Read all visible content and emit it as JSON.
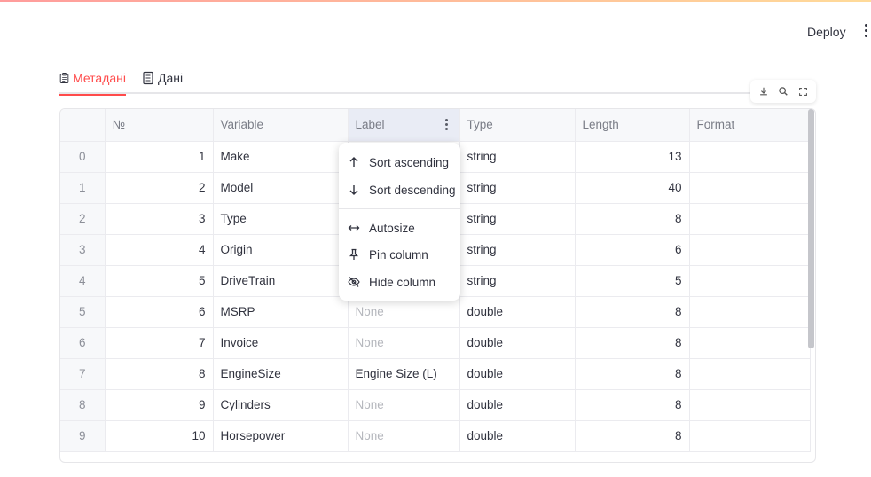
{
  "header": {
    "deploy_label": "Deploy",
    "menu_icon": "kebab-vertical-icon"
  },
  "tabs": [
    {
      "label": "Метадані",
      "icon": "clipboard-icon",
      "active": true
    },
    {
      "label": "Дані",
      "icon": "document-icon",
      "active": false
    }
  ],
  "toolbar": {
    "icons": [
      "download-icon",
      "search-icon",
      "fullscreen-icon"
    ]
  },
  "table": {
    "columns": [
      "",
      "№",
      "Variable",
      "Label",
      "Type",
      "Length",
      "Format"
    ],
    "rows": [
      [
        "0",
        "1",
        "Make",
        "",
        "string",
        "13",
        ""
      ],
      [
        "1",
        "2",
        "Model",
        "",
        "string",
        "40",
        ""
      ],
      [
        "2",
        "3",
        "Type",
        "",
        "string",
        "8",
        ""
      ],
      [
        "3",
        "4",
        "Origin",
        "",
        "string",
        "6",
        ""
      ],
      [
        "4",
        "5",
        "DriveTrain",
        "",
        "string",
        "5",
        ""
      ],
      [
        "5",
        "6",
        "MSRP",
        "None",
        "double",
        "8",
        ""
      ],
      [
        "6",
        "7",
        "Invoice",
        "None",
        "double",
        "8",
        ""
      ],
      [
        "7",
        "8",
        "EngineSize",
        "Engine Size (L)",
        "double",
        "8",
        ""
      ],
      [
        "8",
        "9",
        "Cylinders",
        "None",
        "double",
        "8",
        ""
      ],
      [
        "9",
        "10",
        "Horsepower",
        "None",
        "double",
        "8",
        ""
      ]
    ]
  },
  "column_menu": {
    "items": [
      {
        "label": "Sort ascending",
        "icon": "arrow-up-icon"
      },
      {
        "label": "Sort descending",
        "icon": "arrow-down-icon"
      },
      {
        "label": "Autosize",
        "icon": "resize-horizontal-icon"
      },
      {
        "label": "Pin column",
        "icon": "pin-icon"
      },
      {
        "label": "Hide column",
        "icon": "eye-off-icon"
      }
    ]
  },
  "colors": {
    "accent": "#ff4b4b",
    "text": "#31333f",
    "muted": "#b5b7bd"
  }
}
